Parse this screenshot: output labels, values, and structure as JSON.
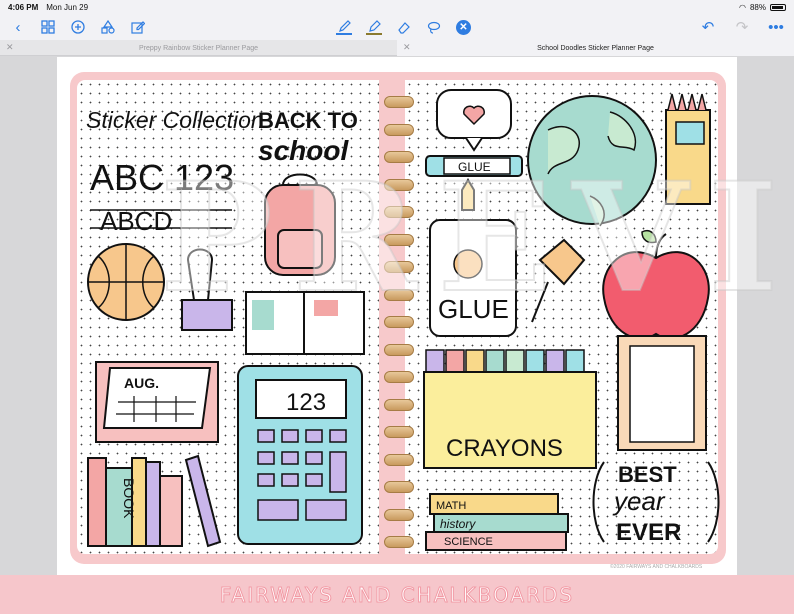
{
  "status_bar": {
    "time": "4:06 PM",
    "date": "Mon Jun 29",
    "battery": "88%",
    "battery_level": 0.88,
    "wifi_icon": "wifi-icon"
  },
  "toolbar": {
    "left_icons": [
      "back-chevron-icon",
      "grid-icon",
      "add-page-icon",
      "shapes-icon",
      "edit-icon"
    ],
    "center_icons": [
      "pen-icon",
      "highlighter-icon",
      "eraser-icon",
      "lasso-icon",
      "close-icon"
    ],
    "right_icons": [
      "undo-icon",
      "redo-icon",
      "more-icon"
    ],
    "accent_color": "#2f7de1"
  },
  "tabs": [
    {
      "label": "Preppy Rainbow Sticker Planner Page",
      "active": false
    },
    {
      "label": "School Doodles Sticker Planner Page",
      "active": true
    }
  ],
  "left_page": {
    "title": "Sticker Collection",
    "back_to_school": "BACK TO SCHOOL",
    "abc": "ABC 123",
    "abcd": "ABCD",
    "calendar_month": "AUG.",
    "calculator_display": "123",
    "book_spine": "BOOK"
  },
  "right_page": {
    "glue_stick": "GLUE",
    "glue_bottle": "GLUE",
    "crayons": "CRAYONS",
    "best_year": [
      "BEST",
      "year",
      "EVER"
    ],
    "book_stack": [
      "MATH",
      "history",
      "SCIENCE"
    ]
  },
  "watermark": "PREVIEW",
  "copyright": "©2020 FAIRWAYS AND CHALKBOARDS",
  "banner": "FAIRWAYS AND CHALKBOARDS"
}
